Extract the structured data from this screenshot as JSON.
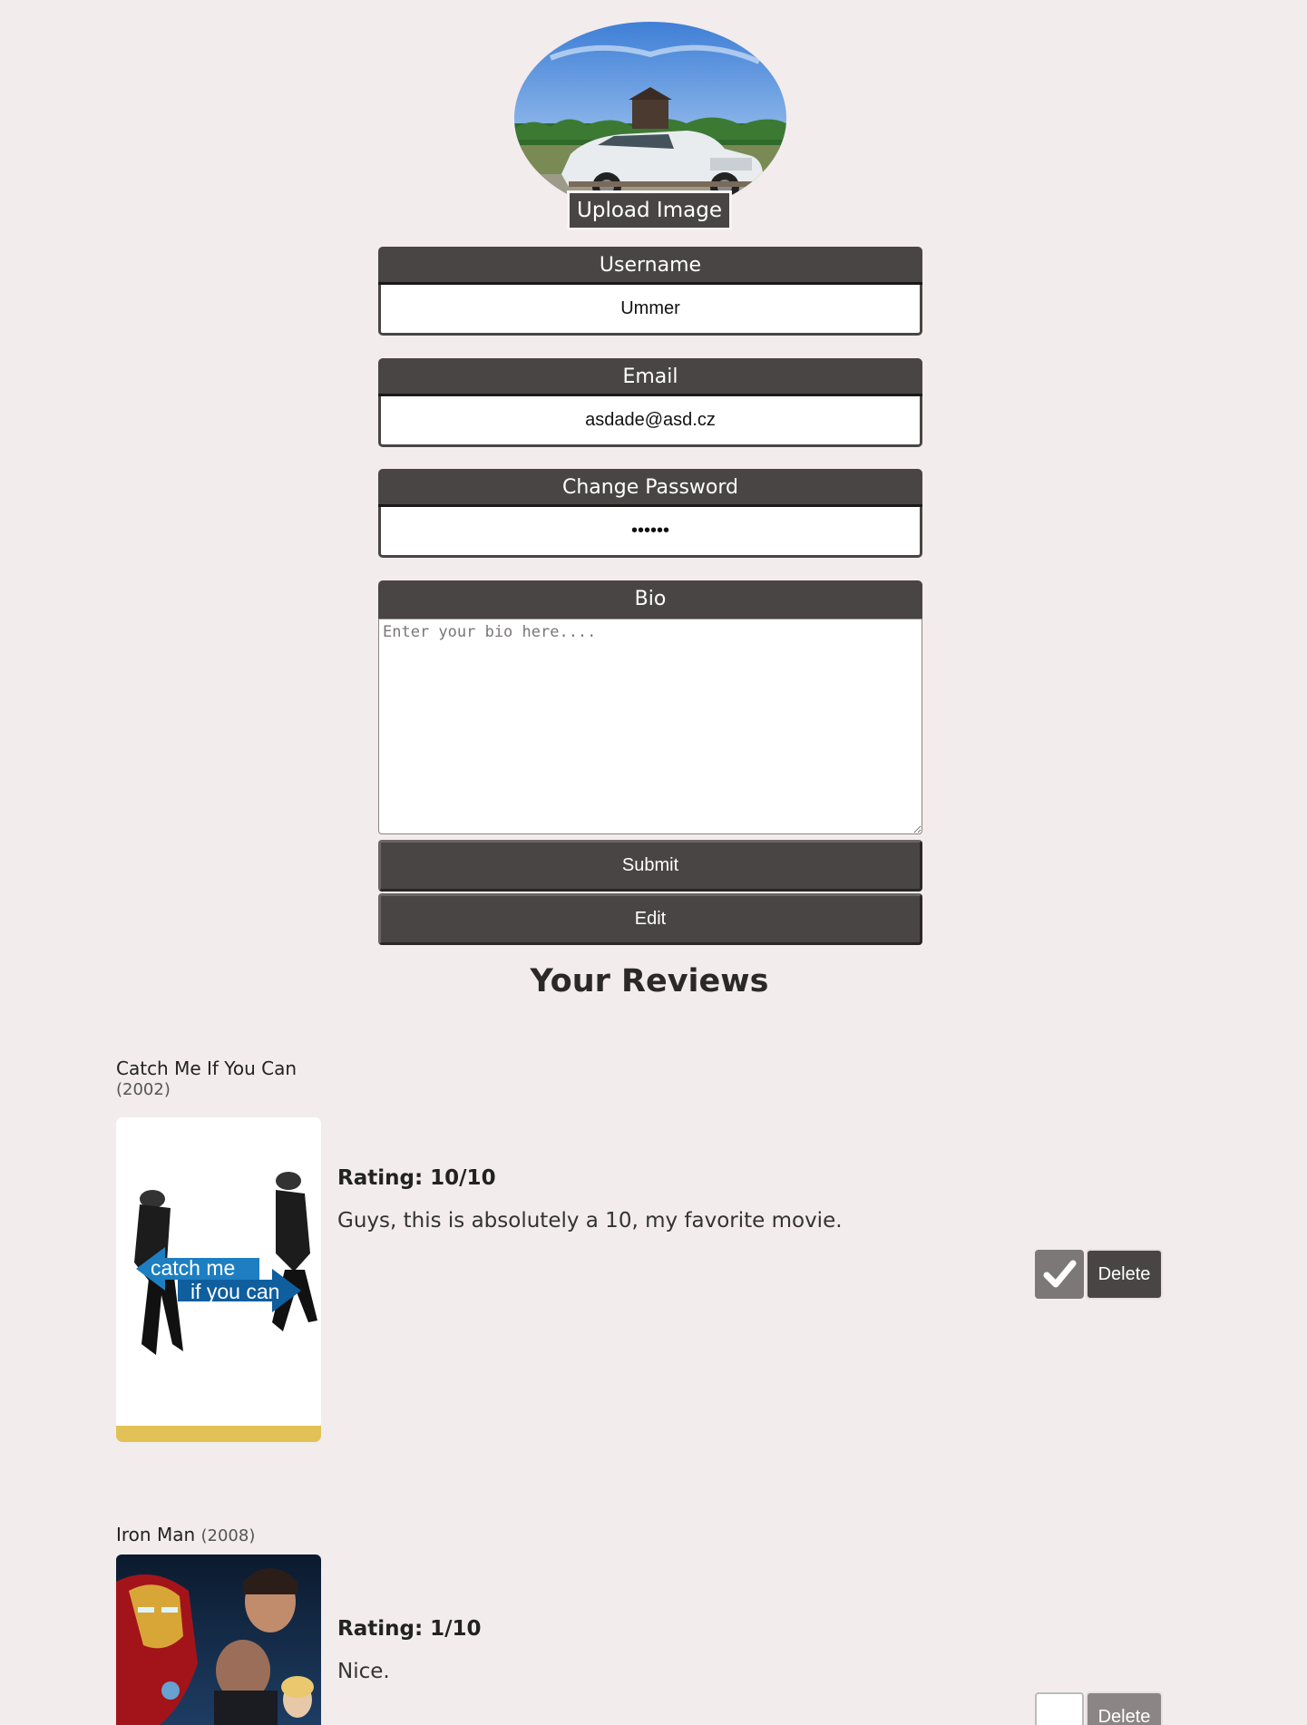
{
  "profile": {
    "upload_label": "Upload Image",
    "username_label": "Username",
    "username_value": "Ummer",
    "email_label": "Email",
    "email_value": "asdade@asd.cz",
    "password_label": "Change Password",
    "password_value": "abcdef",
    "bio_label": "Bio",
    "bio_placeholder": "Enter your bio here....",
    "submit_label": "Submit",
    "edit_label": "Edit"
  },
  "reviews": {
    "heading": "Your Reviews",
    "items": [
      {
        "title": "Catch Me If You Can",
        "year": "(2002)",
        "poster_text_1": "catch me",
        "poster_text_2": "if you can",
        "rating": "Rating: 10/10",
        "text": "Guys, this is absolutely a 10, my favorite movie.",
        "checked": true,
        "delete_label": "Delete"
      },
      {
        "title": "Iron Man",
        "year": "(2008)",
        "rating": "Rating: 1/10",
        "text": "Nice.",
        "checked": false,
        "delete_label": "Delete"
      }
    ]
  },
  "colors": {
    "background": "#f3ecec",
    "panel": "#4a4545",
    "poster_accent": "#e2c157"
  }
}
